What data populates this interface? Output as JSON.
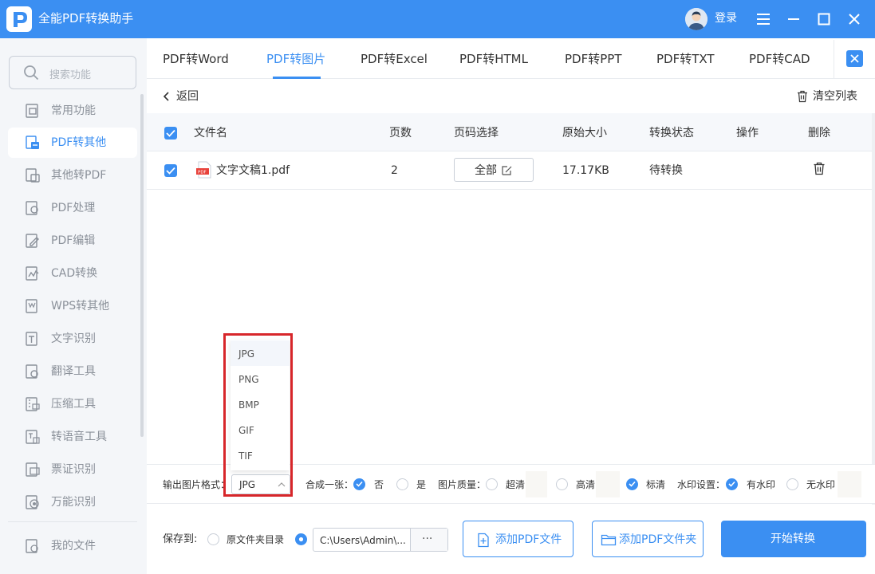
{
  "app": {
    "title": "全能PDF转换助手",
    "login_label": "登录"
  },
  "colors": {
    "accent": "#3b8ff2",
    "highlight": "#d7262a",
    "pdf_icon": "#e8413a"
  },
  "sidebar": {
    "search_placeholder": "搜索功能",
    "items": [
      {
        "label": "常用功能",
        "icon": "common-functions-icon"
      },
      {
        "label": "PDF转其他",
        "icon": "pdf-to-other-icon",
        "active": true
      },
      {
        "label": "其他转PDF",
        "icon": "other-to-pdf-icon"
      },
      {
        "label": "PDF处理",
        "icon": "pdf-process-icon"
      },
      {
        "label": "PDF编辑",
        "icon": "pdf-edit-icon"
      },
      {
        "label": "CAD转换",
        "icon": "cad-convert-icon"
      },
      {
        "label": "WPS转其他",
        "icon": "wps-convert-icon"
      },
      {
        "label": "文字识别",
        "icon": "ocr-icon"
      },
      {
        "label": "翻译工具",
        "icon": "translate-icon"
      },
      {
        "label": "压缩工具",
        "icon": "compress-icon"
      },
      {
        "label": "转语音工具",
        "icon": "text-to-speech-icon"
      },
      {
        "label": "票证识别",
        "icon": "ticket-recognition-icon"
      },
      {
        "label": "万能识别",
        "icon": "universal-recognition-icon"
      }
    ],
    "my_files": "我的文件"
  },
  "tabs": [
    "PDF转Word",
    "PDF转图片",
    "PDF转Excel",
    "PDF转HTML",
    "PDF转PPT",
    "PDF转TXT",
    "PDF转CAD"
  ],
  "active_tab": "PDF转图片",
  "toolbar": {
    "back_label": "返回",
    "clear_label": "清空列表"
  },
  "table": {
    "headers": [
      "文件名",
      "页数",
      "页码选择",
      "原始大小",
      "转换状态",
      "操作",
      "删除"
    ],
    "rows": [
      {
        "checked": true,
        "file_name": "文字文稿1.pdf",
        "pages": "2",
        "page_select": "全部",
        "size": "17.17KB",
        "status": "待转换",
        "operation": ""
      }
    ]
  },
  "options": {
    "format_label": "输出图片格式：",
    "format_value": "JPG",
    "format_options": [
      "JPG",
      "PNG",
      "BMP",
      "GIF",
      "TIF"
    ],
    "merge_label": "合成一张：",
    "merge_no": "否",
    "merge_yes": "是",
    "merge_selected": "否",
    "quality_label": "图片质量：",
    "quality_options": [
      "超清",
      "高清",
      "标清"
    ],
    "quality_selected": "标清",
    "watermark_label": "水印设置：",
    "watermark_options": [
      "有水印",
      "无水印"
    ],
    "watermark_selected": "有水印"
  },
  "bottom": {
    "save_to_label": "保存到:",
    "original_dir_label": "原文件夹目录",
    "path_value": "C:\\Users\\Admin\\...",
    "browse_label": "···",
    "add_file_label": "添加PDF文件",
    "add_folder_label": "添加PDF文件夹",
    "start_label": "开始转换"
  }
}
